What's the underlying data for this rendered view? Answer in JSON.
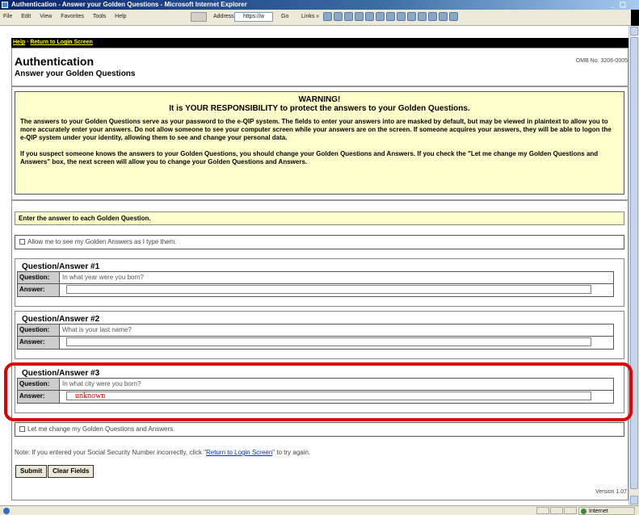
{
  "window": {
    "title": "Authentication - Answer your Golden Questions - Microsoft Internet Explorer",
    "controls": "_ ☐",
    "menu": [
      "File",
      "Edit",
      "View",
      "Favorites",
      "Tools",
      "Help"
    ],
    "address_label": "Address",
    "address_value": "https://w",
    "go_label": "Go",
    "links_label": "Links »"
  },
  "nav": {
    "help": "Help",
    "separator": "·",
    "return_link": "Return to Login Screen"
  },
  "header": {
    "title": "Authentication",
    "subtitle": "Answer your Golden Questions",
    "omb": "OMB No. 3206-0005"
  },
  "warning": {
    "title": "WARNING!",
    "subtitle": "It is YOUR RESPONSIBILITY to protect the answers to your Golden Questions.",
    "paragraph1": "The answers to your Golden Questions serve as your password to the e-QIP system. The fields to enter your answers into are masked by default, but may be viewed in plaintext to allow you to more accurately enter your answers. Do not allow someone to see your computer screen while your answers are on the screen. If someone acquires your answers, they will be able to logon the e-QIP system under your identity, allowing them to see and change your personal data.",
    "paragraph2": "If you suspect someone knows the answers to your Golden Questions, you should change your Golden Questions and Answers. If you check the \"Let me change my Golden Questions and Answers\" box, the next screen will allow you to change your Golden Questions and Answers."
  },
  "instruction": "Enter the answer to each Golden Question.",
  "show_answers_label": "Allow me to see my Golden Answers as I type them.",
  "question_label": "Question:",
  "answer_label": "Answer:",
  "qa": [
    {
      "heading": "Question/Answer #1",
      "question": "In what year were you born?",
      "answer": ""
    },
    {
      "heading": "Question/Answer #2",
      "question": "What is your last name?",
      "answer": ""
    },
    {
      "heading": "Question/Answer #3",
      "question": "In what city were you born?",
      "answer": "unknown"
    }
  ],
  "change_label": "Let me change my Golden Questions and Answers.",
  "note": {
    "before": "Note: If you entered your Social Security Number incorrectly, click \"",
    "link": "Return to Login Screen",
    "after": "\" to try again."
  },
  "buttons": {
    "submit": "Submit",
    "clear": "Clear Fields"
  },
  "version": "Version 1.07",
  "status": {
    "zone": "Internet"
  },
  "colors": {
    "warning_bg": "#ffffcc",
    "highlight": "#e00000",
    "nav_bg": "#000000",
    "nav_text": "#ffff00"
  }
}
